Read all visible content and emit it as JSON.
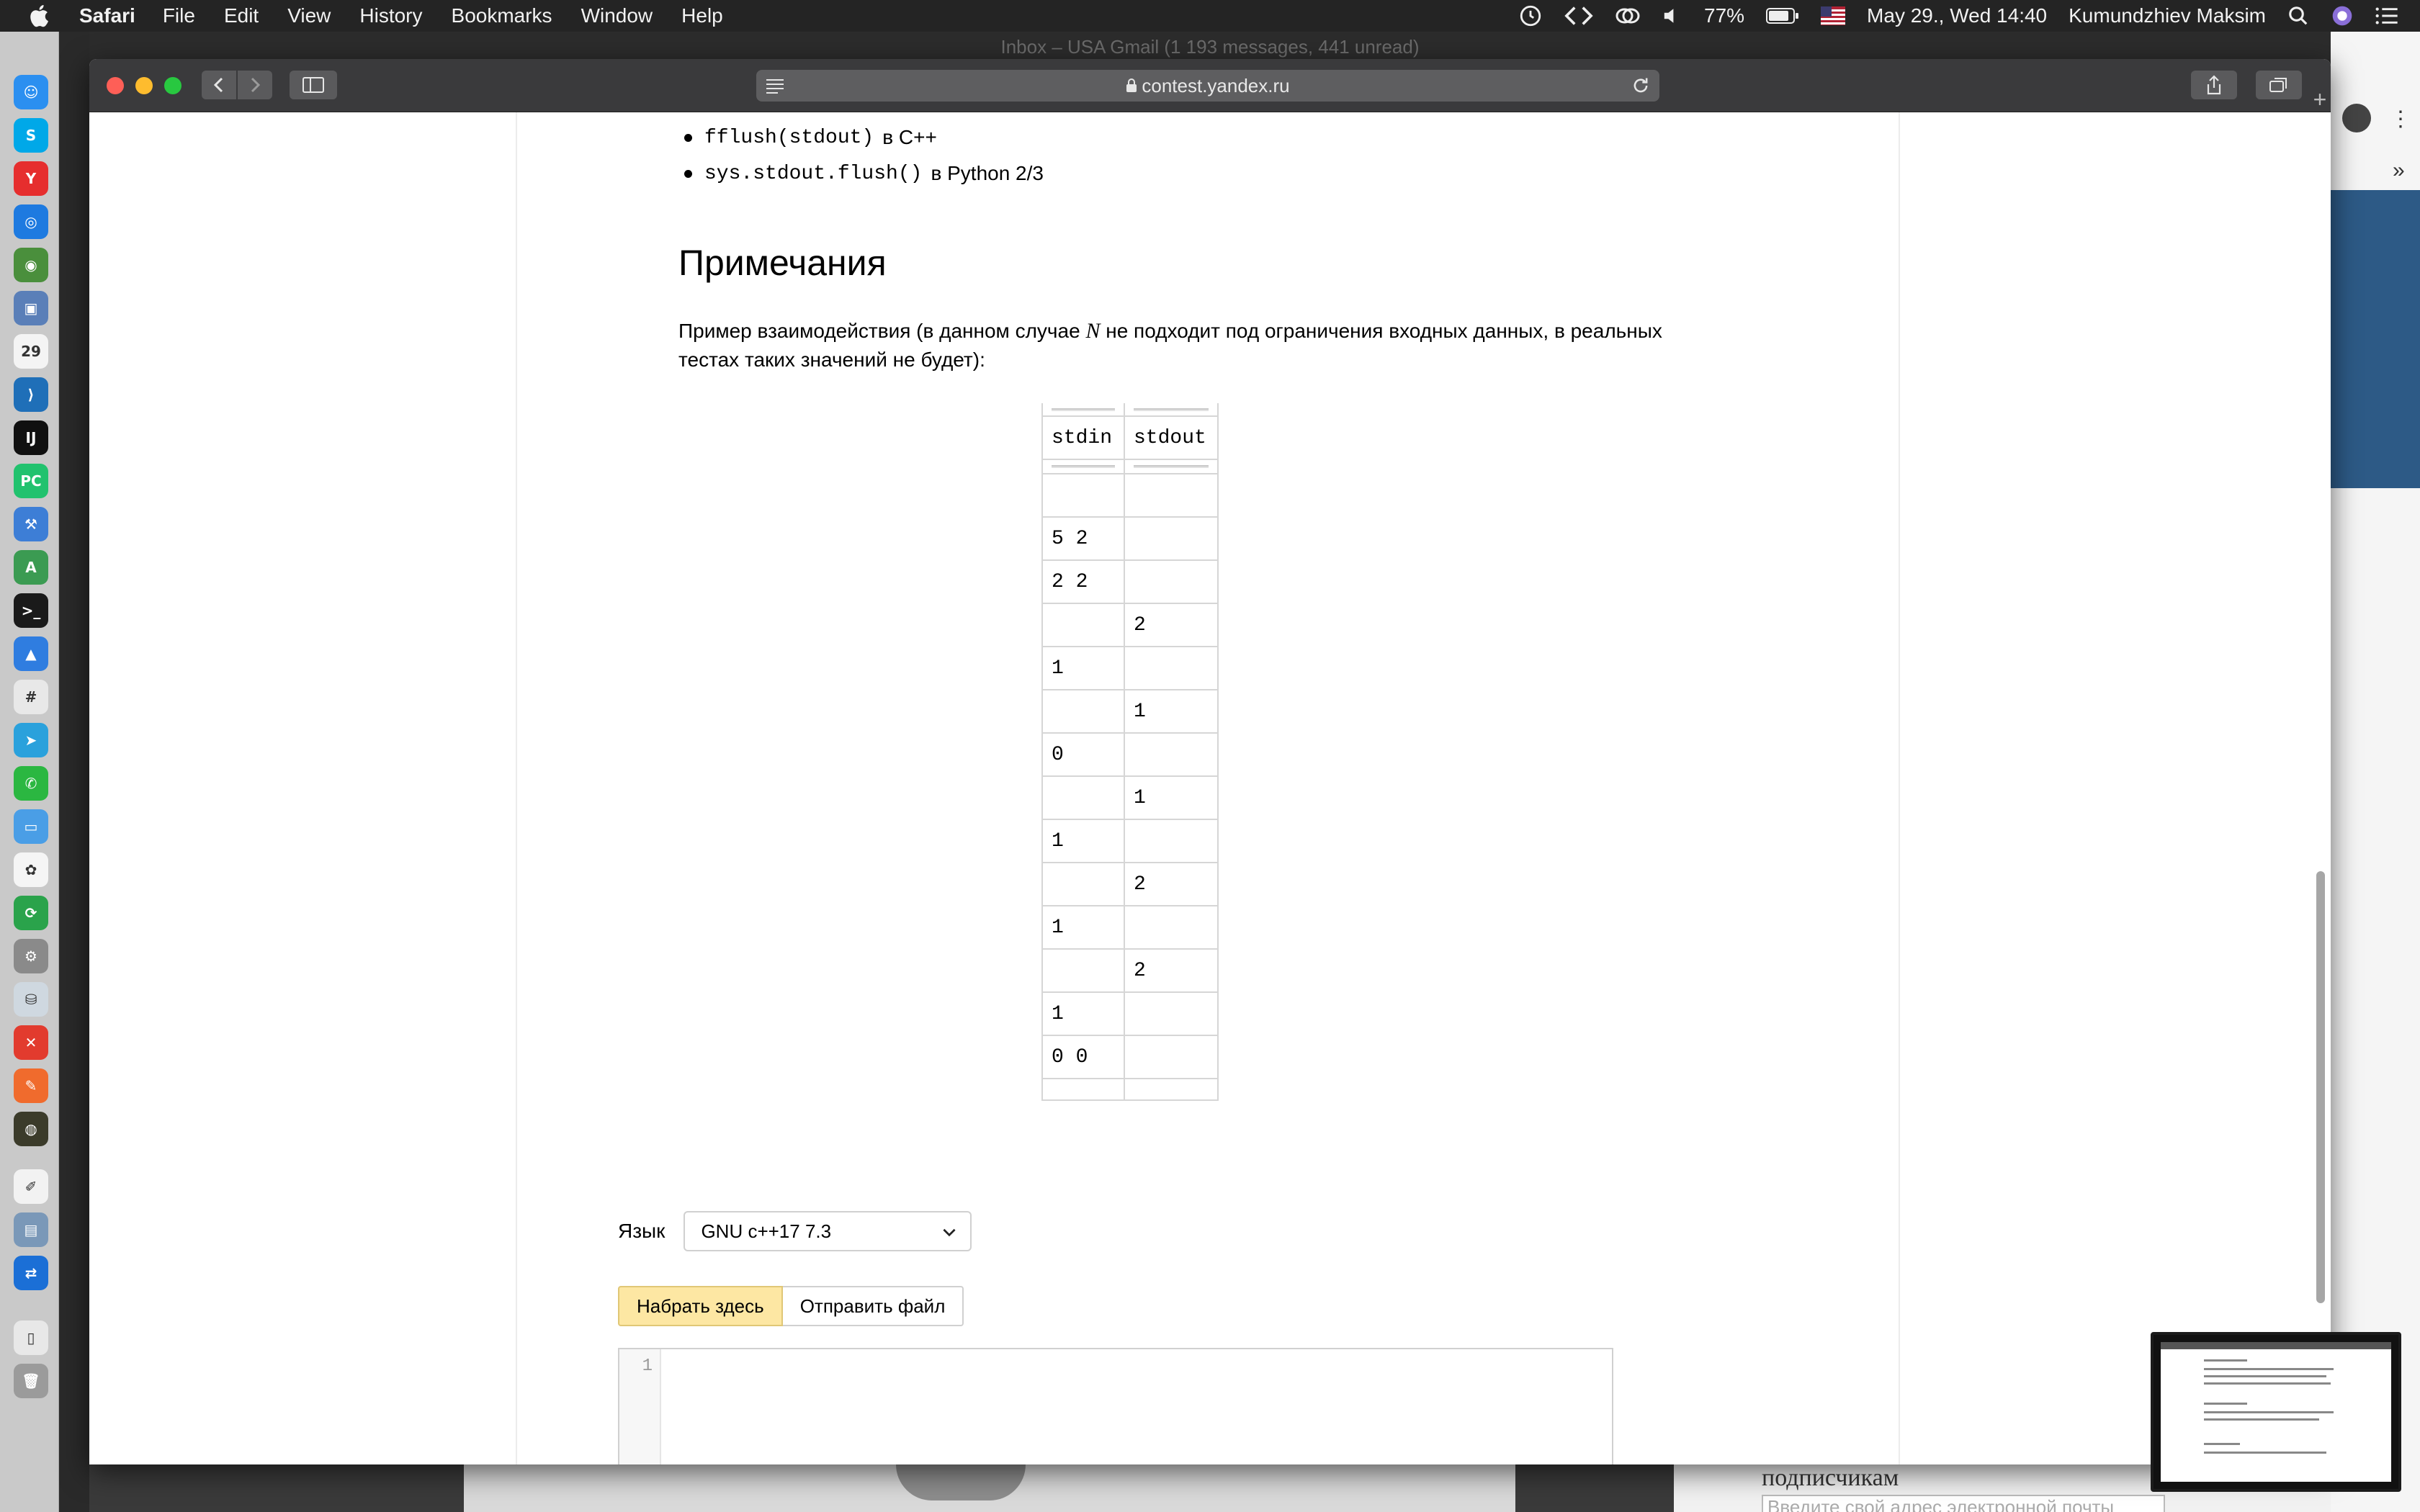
{
  "menubar": {
    "app_name": "Safari",
    "items": [
      "File",
      "Edit",
      "View",
      "History",
      "Bookmarks",
      "Window",
      "Help"
    ],
    "battery": "77%",
    "datetime": "May 29., Wed  14:40",
    "user": "Kumundzhiev Maksim"
  },
  "background": {
    "window_title": "Inbox – USA Gmail (1 193 messages, 441 unread)",
    "subscribe_text": "подписчикам",
    "email_placeholder": "Введите свой адрес электронной почты"
  },
  "dock": {
    "items": [
      {
        "name": "finder-icon",
        "glyph": "☺",
        "color": "#2b8ff0"
      },
      {
        "name": "skype-icon",
        "glyph": "S",
        "color": "#00a8e8"
      },
      {
        "name": "yandex-browser-icon",
        "glyph": "Y",
        "color": "#e62e2e"
      },
      {
        "name": "safari-icon",
        "glyph": "◎",
        "color": "#1e7ae0"
      },
      {
        "name": "chrome-icon",
        "glyph": "◉",
        "color": "#4a8f3c"
      },
      {
        "name": "preview-icon",
        "glyph": "▣",
        "color": "#5a7fb8"
      },
      {
        "name": "calendar-icon",
        "glyph": "29",
        "color": "#f4f4f4"
      },
      {
        "name": "vscode-icon",
        "glyph": "⟩",
        "color": "#1f6fb8"
      },
      {
        "name": "intellij-icon",
        "glyph": "IJ",
        "color": "#101010"
      },
      {
        "name": "pycharm-icon",
        "glyph": "PC",
        "color": "#21c26e"
      },
      {
        "name": "xcode-icon",
        "glyph": "⚒",
        "color": "#3d7ed6"
      },
      {
        "name": "android-studio-icon",
        "glyph": "A",
        "color": "#3b9b52"
      },
      {
        "name": "terminal-icon",
        "glyph": ">_",
        "color": "#1a1a1a"
      },
      {
        "name": "keynote-icon",
        "glyph": "▲",
        "color": "#2f7de0"
      },
      {
        "name": "slack-icon",
        "glyph": "#",
        "color": "#e8e8e8"
      },
      {
        "name": "telegram-icon",
        "glyph": "➤",
        "color": "#2aa1dc"
      },
      {
        "name": "whatsapp-icon",
        "glyph": "✆",
        "color": "#2bb741"
      },
      {
        "name": "folder-icon",
        "glyph": "▭",
        "color": "#4a9ee6"
      },
      {
        "name": "photos-icon",
        "glyph": "✿",
        "color": "#f5f5f5"
      },
      {
        "name": "refresh-app-icon",
        "glyph": "⟳",
        "color": "#2aa34b"
      },
      {
        "name": "system-preferences-icon",
        "glyph": "⚙",
        "color": "#8a8a8a"
      },
      {
        "name": "database-icon",
        "glyph": "⛁",
        "color": "#cfd8e0"
      },
      {
        "name": "xmind-icon",
        "glyph": "✕",
        "color": "#e23b2e"
      },
      {
        "name": "postman-icon",
        "glyph": "✎",
        "color": "#f06b2d"
      },
      {
        "name": "radar-icon",
        "glyph": "◍",
        "color": "#3b3b2a"
      },
      {
        "name": "textedit-icon",
        "glyph": "✐",
        "color": "#f2f2f2"
      },
      {
        "name": "image-capture-icon",
        "glyph": "▤",
        "color": "#7a98b8"
      },
      {
        "name": "teamviewer-icon",
        "glyph": "⇄",
        "color": "#1b6fd6"
      },
      {
        "name": "document-icon",
        "glyph": "▯",
        "color": "#e8e8e8"
      },
      {
        "name": "trash-icon",
        "glyph": "🗑",
        "color": "#9b9b9b"
      }
    ]
  },
  "browser": {
    "url": "contest.yandex.ru"
  },
  "page": {
    "bullets": [
      {
        "code": "fflush(stdout)",
        "text": "в C++"
      },
      {
        "code": "sys.stdout.flush()",
        "text": "в Python 2/3"
      }
    ],
    "notes_heading": "Примечания",
    "example_text_before": "Пример взаимодействия (в данном случае",
    "example_var": "N",
    "example_text_after": "не подходит под ограничения входных данных, в реальных тестах таких значений не будет):",
    "table": {
      "headers": [
        "stdin",
        "stdout"
      ],
      "rows": [
        [
          "",
          ""
        ],
        [
          "5 2",
          ""
        ],
        [
          "2 2",
          ""
        ],
        [
          "",
          "2"
        ],
        [
          "1",
          ""
        ],
        [
          "",
          "1"
        ],
        [
          "0",
          ""
        ],
        [
          "",
          "1"
        ],
        [
          "1",
          ""
        ],
        [
          "",
          "2"
        ],
        [
          "1",
          ""
        ],
        [
          "",
          "2"
        ],
        [
          "1",
          ""
        ],
        [
          "0 0",
          ""
        ]
      ]
    },
    "language_label": "Язык",
    "language_value": "GNU c++17 7.3",
    "tab_type_here": "Набрать здесь",
    "tab_send_file": "Отправить файл",
    "editor_line": "1"
  }
}
